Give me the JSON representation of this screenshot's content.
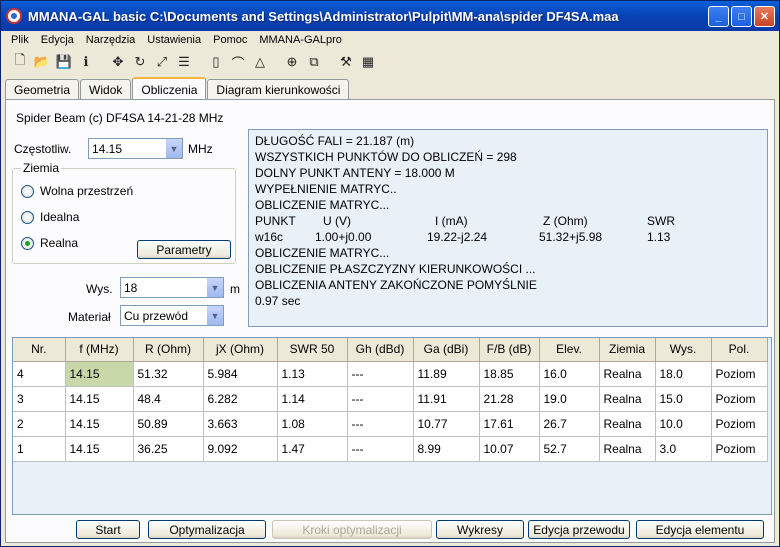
{
  "window": {
    "title": "MMANA-GAL basic C:\\Documents and Settings\\Administrator\\Pulpit\\MM-ana\\spider DF4SA.maa"
  },
  "menu": [
    "Plik",
    "Edycja",
    "Narzędzia",
    "Ustawienia",
    "Pomoc",
    "MMANA-GALpro"
  ],
  "toolbar_icons": [
    "new-file-icon",
    "open-folder-icon",
    "save-icon",
    "info-icon",
    "move-icon",
    "rotate-icon",
    "scale-icon",
    "tune-icon",
    "page-icon",
    "measure-icon",
    "triangle-icon",
    "target-icon",
    "copy-icon",
    "tools-icon",
    "calculator-icon"
  ],
  "tabs": [
    "Geometria",
    "Widok",
    "Obliczenia",
    "Diagram kierunkowości"
  ],
  "active_tab": "Obliczenia",
  "antenna_title": "Spider Beam (c) DF4SA  14-21-28 MHz",
  "freq": {
    "label": "Częstotliw.",
    "value": "14.15",
    "unit": "MHz"
  },
  "ground": {
    "label": "Ziemia",
    "options": [
      "Wolna przestrzeń",
      "Idealna",
      "Realna"
    ],
    "selected": "Realna",
    "params_button": "Parametry"
  },
  "height": {
    "label": "Wys.",
    "value": "18",
    "unit": "m"
  },
  "material": {
    "label": "Materiał",
    "value": "Cu przewód"
  },
  "output": {
    "lines_top": [
      "DŁUGOŚĆ FALI = 21.187 (m)",
      "WSZYSTKICH PUNKTÓW DO OBLICZEŃ = 298",
      "DOLNY PUNKT ANTENY = 18.000 M",
      "WYPEŁNIENIE MATRYC..",
      "OBLICZENIE MATRYC..."
    ],
    "header_cols": [
      "PUNKT",
      "U (V)",
      "I (mA)",
      "Z (Ohm)",
      "SWR"
    ],
    "value_cols": [
      "w16c",
      "1.00+j0.00",
      "19.22-j2.24",
      "51.32+j5.98",
      "1.13"
    ],
    "lines_bottom": [
      "OBLICZENIE MATRYC...",
      "OBLICZENIE PŁASZCZYZNY KIERUNKOWOŚCI ...",
      "OBLICZENIA ANTENY ZAKOŃCZONE POMYŚLNIE",
      "0.97 sec"
    ]
  },
  "table": {
    "headers": [
      "Nr.",
      "f (MHz)",
      "R (Ohm)",
      "jX (Ohm)",
      "SWR 50",
      "Gh (dBd)",
      "Ga (dBi)",
      "F/B (dB)",
      "Elev.",
      "Ziemia",
      "Wys.",
      "Pol."
    ],
    "rows": [
      [
        "4",
        "14.15",
        "51.32",
        "5.984",
        "1.13",
        "---",
        "11.89",
        "18.85",
        "16.0",
        "Realna",
        "18.0",
        "Poziom"
      ],
      [
        "3",
        "14.15",
        "48.4",
        "6.282",
        "1.14",
        "---",
        "11.91",
        "21.28",
        "19.0",
        "Realna",
        "15.0",
        "Poziom"
      ],
      [
        "2",
        "14.15",
        "50.89",
        "3.663",
        "1.08",
        "---",
        "10.77",
        "17.61",
        "26.7",
        "Realna",
        "10.0",
        "Poziom"
      ],
      [
        "1",
        "14.15",
        "36.25",
        "9.092",
        "1.47",
        "---",
        "8.99",
        "10.07",
        "52.7",
        "Realna",
        "3.0",
        "Poziom"
      ]
    ]
  },
  "buttons": {
    "start": "Start",
    "optimize": "Optymalizacja",
    "opt_steps": "Kroki optymalizacji",
    "plots": "Wykresy",
    "edit_wire": "Edycja przewodu",
    "edit_element": "Edycja elementu"
  }
}
